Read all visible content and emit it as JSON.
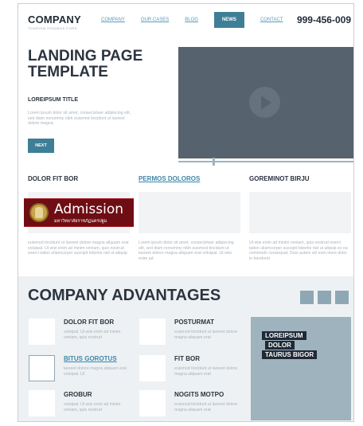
{
  "header": {
    "logo": "COMPANY",
    "tagline": "TOURISM IPSUMUS FORS",
    "nav": [
      "COMPANY",
      "OUR CASES",
      "BLOG",
      "NEWS",
      "CONTACT"
    ],
    "active_nav": "NEWS",
    "phone": "999-456-009"
  },
  "hero": {
    "title": "LANDING PAGE TEMPLATE",
    "subtitle": "LOREIPSUM TITLE",
    "text": "Lorem ipsum dolor sit amet, consectetuer adipiscing elit, sed diam nonummy nibh euismod tincidunt ut laoreet dolore magna",
    "button": "NEXT",
    "video_icon": "play-icon"
  },
  "columns": [
    {
      "title": "DOLOR FIT BOR",
      "link": false,
      "text": "euismod tincidunt ut laoreet dolore magna aliquam erat volutpat. Ut wisi enim ad minim veniam, quis nostrud exerci tation ullamcorper suscipit lobortis nisl ut aliquip"
    },
    {
      "title": "PERMOS DOLOROS",
      "link": true,
      "text": "Lorem ipsum dolor sit amet, consectetuer adipiscing elit, sed diam nonummy nibh euismod tincidunt ut laoreet dolore magna aliquam erat volutpat. Ut wisi enim ad"
    },
    {
      "title": "GOREMINOT BIRJU",
      "link": false,
      "text": "Ut wisi enim ad minim veniam, quis nostrud exerci tation ullamcorper suscipit lobortis nisl ut aliquip ex ea commodo consequat. Duis autem vel eum iriure dolor in hendrerit"
    }
  ],
  "admission": {
    "title": "Admission",
    "subtitle": "มหาวิทยาลัยราชภัฏนครปฐม"
  },
  "advantages": {
    "title": "COMPANY ADVANTAGES",
    "items": [
      {
        "title": "DOLOR FIT BOR",
        "text": "volutpat. Ut wisi enim ad minim veniam, quis nostrud",
        "link": false
      },
      {
        "title": "POSTURMAT",
        "text": "euismod tincidunt ut laoreet dolore magna aliquam erat",
        "link": false
      },
      {
        "title": "BITUS GOROTUS",
        "text": "laoreet dolore magna aliquam erat volutpat. Ut",
        "link": true
      },
      {
        "title": "FIT BOR",
        "text": "euismod tincidunt ut laoreet dolore magna aliquam erat",
        "link": false
      },
      {
        "title": "GROBUR",
        "text": "volutpat. Ut wisi enim ad minim veniam, quis nostrud",
        "link": false
      },
      {
        "title": "NOGITS MOTPO",
        "text": "euismod tincidunt ut laoreet dolore magna aliquam erat",
        "link": false
      }
    ],
    "tags": [
      "LOREIPSUM",
      "DOLOR",
      "TAURUS BIGOR"
    ]
  },
  "colors": {
    "accent": "#3f7e97",
    "link": "#3f86a8",
    "dark": "#2b3440",
    "video": "#56626d",
    "panel": "#9fb3bf",
    "admission_bg": "#6e0e14"
  }
}
